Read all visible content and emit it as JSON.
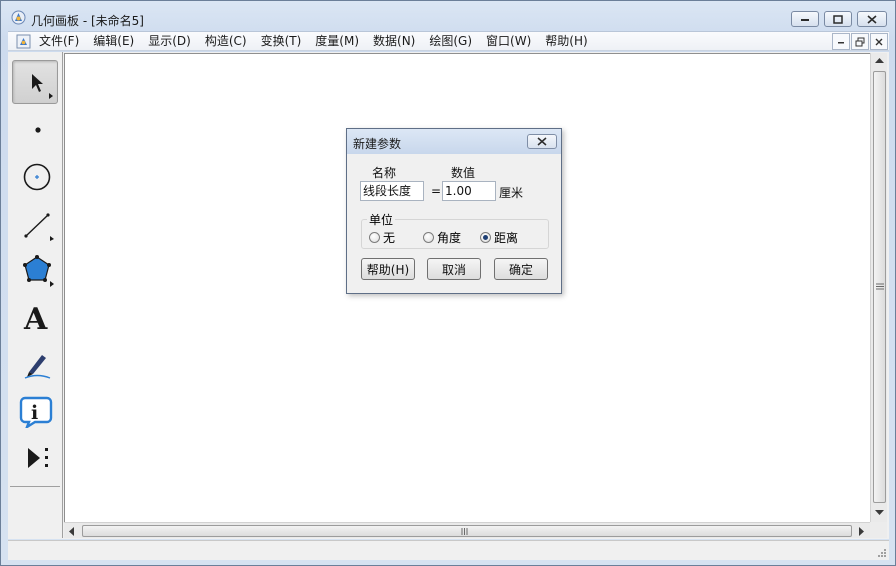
{
  "window": {
    "title": "几何画板 - [未命名5]"
  },
  "menu": {
    "items": [
      "文件(F)",
      "编辑(E)",
      "显示(D)",
      "构造(C)",
      "变换(T)",
      "度量(M)",
      "数据(N)",
      "绘图(G)",
      "窗口(W)",
      "帮助(H)"
    ]
  },
  "toolbox": {
    "tools": [
      {
        "name": "arrow-select-icon",
        "selected": true
      },
      {
        "name": "point-icon"
      },
      {
        "name": "compass-icon"
      },
      {
        "name": "straightedge-icon"
      },
      {
        "name": "polygon-icon"
      },
      {
        "name": "text-icon",
        "glyph": "A"
      },
      {
        "name": "marker-icon"
      },
      {
        "name": "information-icon",
        "glyph": "i"
      },
      {
        "name": "custom-tool-icon"
      }
    ]
  },
  "dialog": {
    "title": "新建参数",
    "name_label": "名称",
    "value_label": "数值",
    "name_value": "线段长度",
    "equals": "=",
    "number_value": "1.00",
    "unit_suffix": "厘米",
    "units_group_label": "单位",
    "unit_options": [
      {
        "label": "无",
        "checked": false
      },
      {
        "label": "角度",
        "checked": false
      },
      {
        "label": "距离",
        "checked": true
      }
    ],
    "help_button": "帮助(H)",
    "cancel_button": "取消",
    "ok_button": "确定"
  },
  "colors": {
    "accent": "#1f6fb7",
    "dialog_title": "#cfdcef"
  }
}
